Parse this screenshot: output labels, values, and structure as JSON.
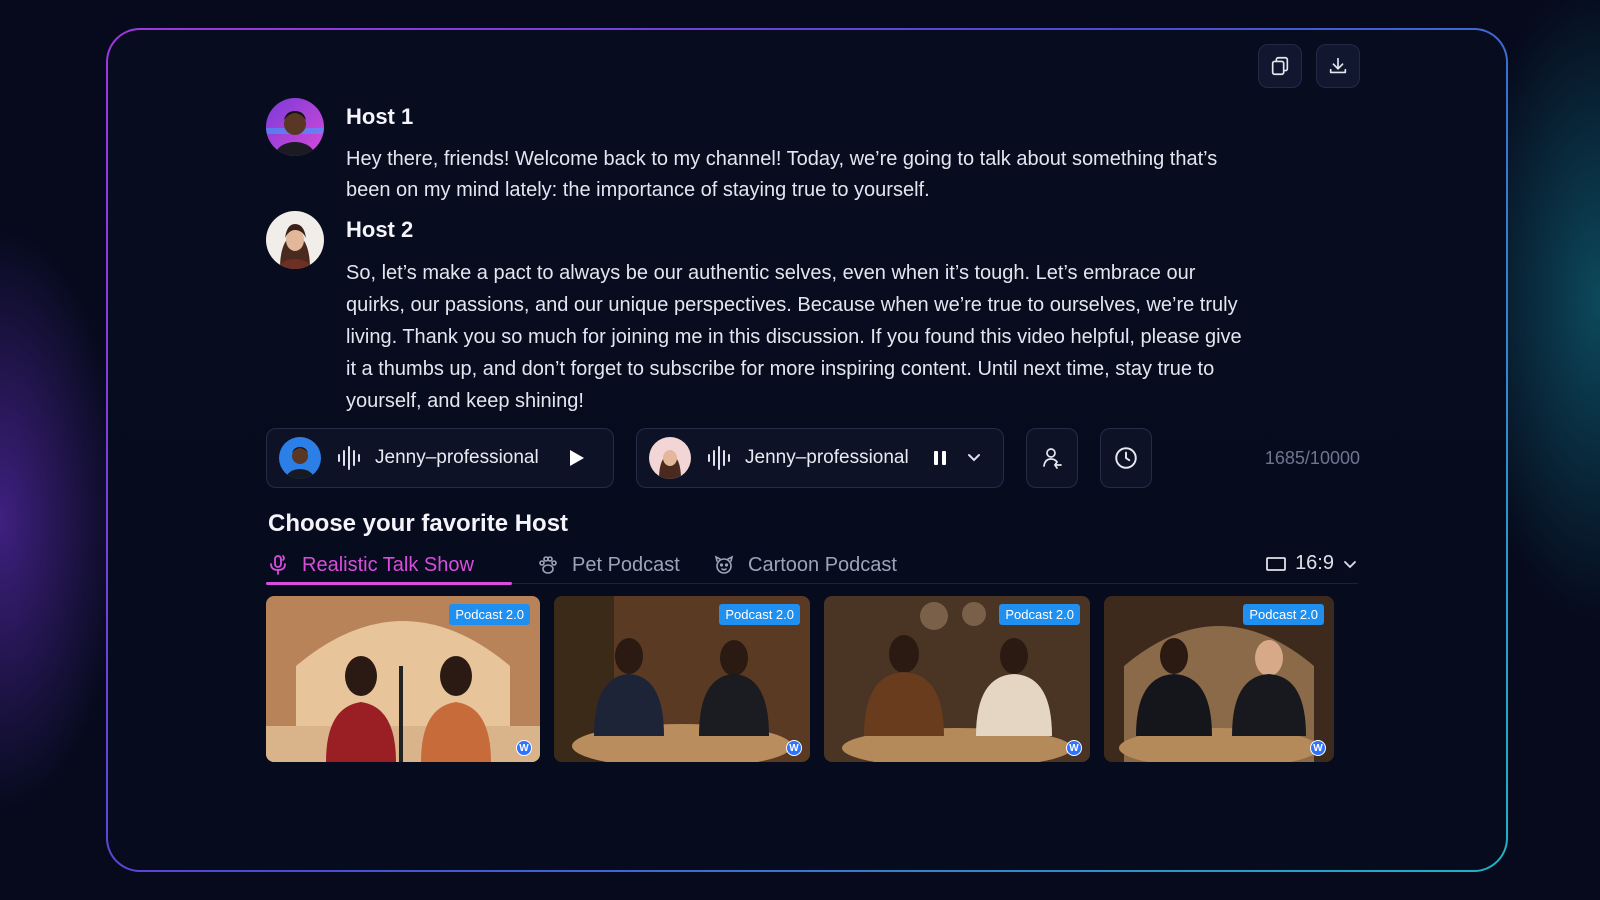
{
  "toolbar": {
    "copy_icon": "copy-icon",
    "download_icon": "download-icon"
  },
  "messages": [
    {
      "name": "Host 1",
      "text": "Hey there, friends! Welcome back to my channel! Today, we’re going to talk about something that’s been on my mind lately: the importance of staying true to yourself."
    },
    {
      "name": "Host 2",
      "text": "So, let’s make a pact to always be our authentic selves, even when it’s tough. Let’s embrace our quirks, our passions, and our unique perspectives. Because when we’re true to ourselves, we’re truly living. Thank you so much for joining me in this discussion. If you found this video helpful, please give it a thumbs up, and don’t forget to subscribe for more inspiring content. Until next time, stay true to yourself, and keep shining!"
    }
  ],
  "voices": [
    {
      "voice": "Jenny–professional",
      "state_icon": "play-icon"
    },
    {
      "voice": "Jenny–professional",
      "state_icon": "pause-icon"
    }
  ],
  "counter": "1685/10000",
  "choose": {
    "title": "Choose your favorite Host",
    "tabs": [
      {
        "label": "Realistic Talk Show",
        "icon": "microphone-icon",
        "active": true
      },
      {
        "label": "Pet Podcast",
        "icon": "paw-icon",
        "active": false
      },
      {
        "label": "Cartoon Podcast",
        "icon": "cartoon-face-icon",
        "active": false
      }
    ],
    "ratio": "16:9"
  },
  "thumbnails": [
    {
      "badge": "Podcast 2.0",
      "mark": "W"
    },
    {
      "badge": "Podcast 2.0",
      "mark": "W"
    },
    {
      "badge": "Podcast 2.0",
      "mark": "W"
    },
    {
      "badge": "Podcast 2.0",
      "mark": "W"
    }
  ],
  "colors": {
    "accent": "#d94dde",
    "badge": "#1f8ff0",
    "frame_start": "#a136e0",
    "frame_end": "#1fb3c4"
  }
}
